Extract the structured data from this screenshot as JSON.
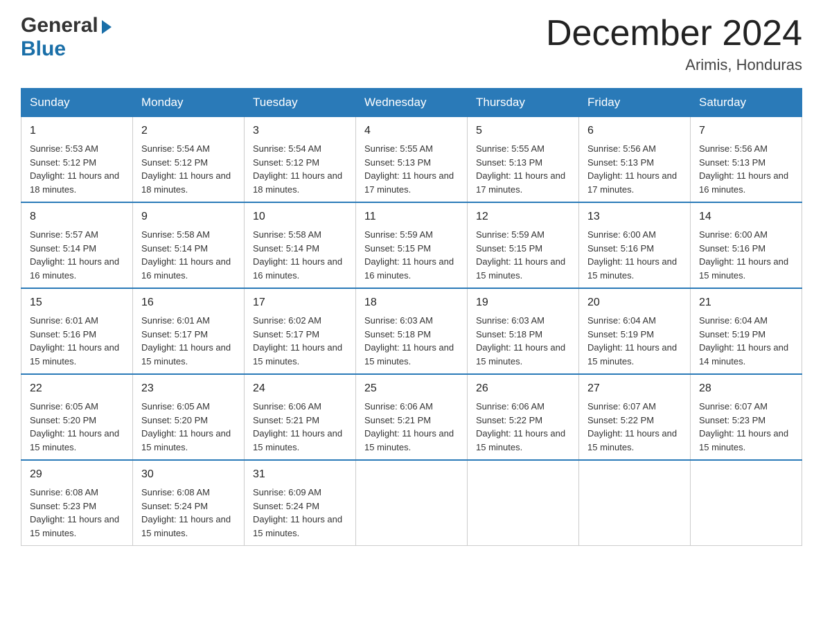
{
  "header": {
    "logo_general": "General",
    "logo_blue": "Blue",
    "month_title": "December 2024",
    "location": "Arimis, Honduras"
  },
  "weekdays": [
    "Sunday",
    "Monday",
    "Tuesday",
    "Wednesday",
    "Thursday",
    "Friday",
    "Saturday"
  ],
  "weeks": [
    [
      {
        "day": "1",
        "sunrise": "5:53 AM",
        "sunset": "5:12 PM",
        "daylight": "11 hours and 18 minutes."
      },
      {
        "day": "2",
        "sunrise": "5:54 AM",
        "sunset": "5:12 PM",
        "daylight": "11 hours and 18 minutes."
      },
      {
        "day": "3",
        "sunrise": "5:54 AM",
        "sunset": "5:12 PM",
        "daylight": "11 hours and 18 minutes."
      },
      {
        "day": "4",
        "sunrise": "5:55 AM",
        "sunset": "5:13 PM",
        "daylight": "11 hours and 17 minutes."
      },
      {
        "day": "5",
        "sunrise": "5:55 AM",
        "sunset": "5:13 PM",
        "daylight": "11 hours and 17 minutes."
      },
      {
        "day": "6",
        "sunrise": "5:56 AM",
        "sunset": "5:13 PM",
        "daylight": "11 hours and 17 minutes."
      },
      {
        "day": "7",
        "sunrise": "5:56 AM",
        "sunset": "5:13 PM",
        "daylight": "11 hours and 16 minutes."
      }
    ],
    [
      {
        "day": "8",
        "sunrise": "5:57 AM",
        "sunset": "5:14 PM",
        "daylight": "11 hours and 16 minutes."
      },
      {
        "day": "9",
        "sunrise": "5:58 AM",
        "sunset": "5:14 PM",
        "daylight": "11 hours and 16 minutes."
      },
      {
        "day": "10",
        "sunrise": "5:58 AM",
        "sunset": "5:14 PM",
        "daylight": "11 hours and 16 minutes."
      },
      {
        "day": "11",
        "sunrise": "5:59 AM",
        "sunset": "5:15 PM",
        "daylight": "11 hours and 16 minutes."
      },
      {
        "day": "12",
        "sunrise": "5:59 AM",
        "sunset": "5:15 PM",
        "daylight": "11 hours and 15 minutes."
      },
      {
        "day": "13",
        "sunrise": "6:00 AM",
        "sunset": "5:16 PM",
        "daylight": "11 hours and 15 minutes."
      },
      {
        "day": "14",
        "sunrise": "6:00 AM",
        "sunset": "5:16 PM",
        "daylight": "11 hours and 15 minutes."
      }
    ],
    [
      {
        "day": "15",
        "sunrise": "6:01 AM",
        "sunset": "5:16 PM",
        "daylight": "11 hours and 15 minutes."
      },
      {
        "day": "16",
        "sunrise": "6:01 AM",
        "sunset": "5:17 PM",
        "daylight": "11 hours and 15 minutes."
      },
      {
        "day": "17",
        "sunrise": "6:02 AM",
        "sunset": "5:17 PM",
        "daylight": "11 hours and 15 minutes."
      },
      {
        "day": "18",
        "sunrise": "6:03 AM",
        "sunset": "5:18 PM",
        "daylight": "11 hours and 15 minutes."
      },
      {
        "day": "19",
        "sunrise": "6:03 AM",
        "sunset": "5:18 PM",
        "daylight": "11 hours and 15 minutes."
      },
      {
        "day": "20",
        "sunrise": "6:04 AM",
        "sunset": "5:19 PM",
        "daylight": "11 hours and 15 minutes."
      },
      {
        "day": "21",
        "sunrise": "6:04 AM",
        "sunset": "5:19 PM",
        "daylight": "11 hours and 14 minutes."
      }
    ],
    [
      {
        "day": "22",
        "sunrise": "6:05 AM",
        "sunset": "5:20 PM",
        "daylight": "11 hours and 15 minutes."
      },
      {
        "day": "23",
        "sunrise": "6:05 AM",
        "sunset": "5:20 PM",
        "daylight": "11 hours and 15 minutes."
      },
      {
        "day": "24",
        "sunrise": "6:06 AM",
        "sunset": "5:21 PM",
        "daylight": "11 hours and 15 minutes."
      },
      {
        "day": "25",
        "sunrise": "6:06 AM",
        "sunset": "5:21 PM",
        "daylight": "11 hours and 15 minutes."
      },
      {
        "day": "26",
        "sunrise": "6:06 AM",
        "sunset": "5:22 PM",
        "daylight": "11 hours and 15 minutes."
      },
      {
        "day": "27",
        "sunrise": "6:07 AM",
        "sunset": "5:22 PM",
        "daylight": "11 hours and 15 minutes."
      },
      {
        "day": "28",
        "sunrise": "6:07 AM",
        "sunset": "5:23 PM",
        "daylight": "11 hours and 15 minutes."
      }
    ],
    [
      {
        "day": "29",
        "sunrise": "6:08 AM",
        "sunset": "5:23 PM",
        "daylight": "11 hours and 15 minutes."
      },
      {
        "day": "30",
        "sunrise": "6:08 AM",
        "sunset": "5:24 PM",
        "daylight": "11 hours and 15 minutes."
      },
      {
        "day": "31",
        "sunrise": "6:09 AM",
        "sunset": "5:24 PM",
        "daylight": "11 hours and 15 minutes."
      },
      null,
      null,
      null,
      null
    ]
  ],
  "labels": {
    "sunrise": "Sunrise:",
    "sunset": "Sunset:",
    "daylight": "Daylight:"
  }
}
